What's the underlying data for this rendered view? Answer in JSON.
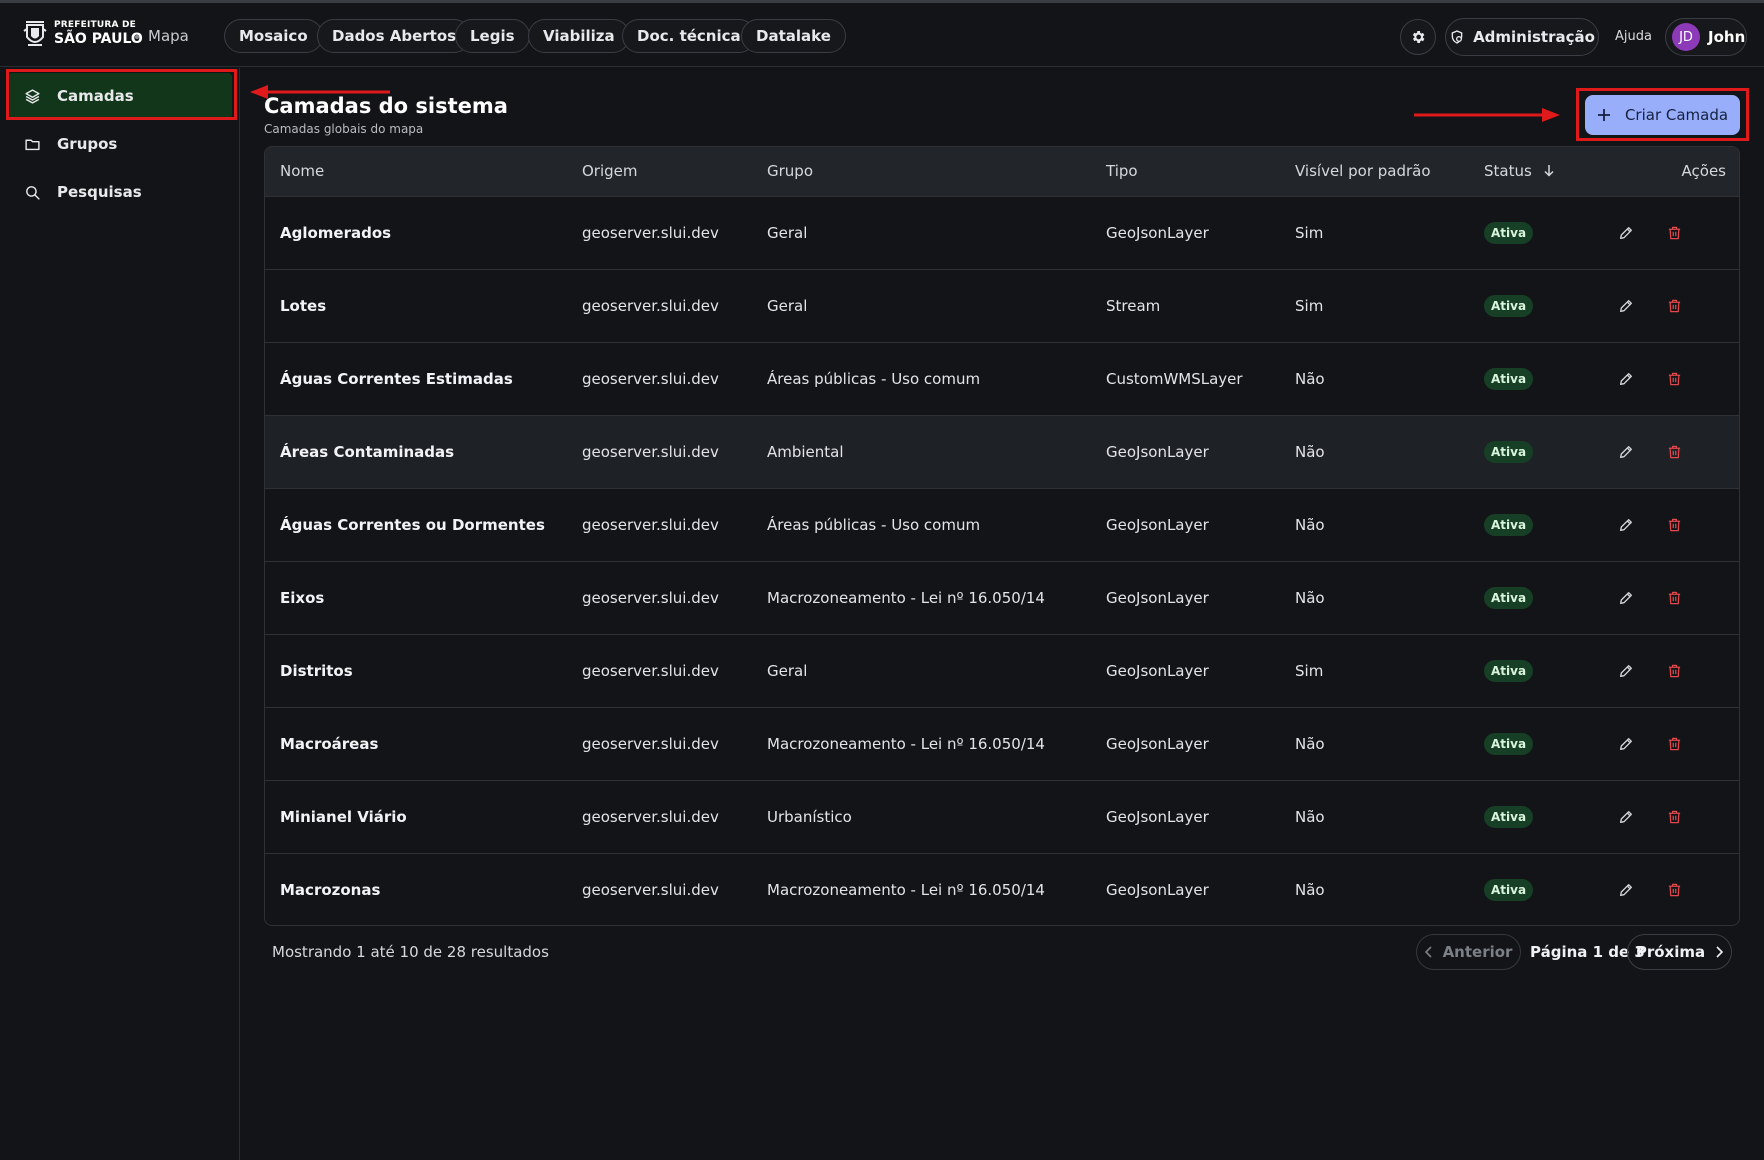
{
  "header": {
    "logo_top": "PREFEITURA DE",
    "logo_main": "SÃO PAULO",
    "app_name": "Mapa",
    "nav": [
      "Mosaico",
      "Dados Abertos",
      "Legis",
      "Viabiliza",
      "Doc. técnica",
      "Datalake"
    ],
    "admin_label": "Administração",
    "help_label": "Ajuda",
    "user_initials": "JD",
    "user_name": "John"
  },
  "sidebar": {
    "items": [
      {
        "label": "Camadas",
        "icon": "layers-icon",
        "active": true
      },
      {
        "label": "Grupos",
        "icon": "folder-icon",
        "active": false
      },
      {
        "label": "Pesquisas",
        "icon": "search-icon",
        "active": false
      }
    ]
  },
  "main": {
    "title": "Camadas do sistema",
    "subtitle": "Camadas globais do mapa",
    "create_label": "Criar Camada",
    "columns": [
      "Nome",
      "Origem",
      "Grupo",
      "Tipo",
      "Visível por padrão",
      "Status",
      "Ações"
    ],
    "rows": [
      {
        "nome": "Aglomerados",
        "origem": "geoserver.slui.dev",
        "grupo": "Geral",
        "tipo": "GeoJsonLayer",
        "visivel": "Sim",
        "status": "Ativa"
      },
      {
        "nome": "Lotes",
        "origem": "geoserver.slui.dev",
        "grupo": "Geral",
        "tipo": "Stream",
        "visivel": "Sim",
        "status": "Ativa"
      },
      {
        "nome": "Águas Correntes Estimadas",
        "origem": "geoserver.slui.dev",
        "grupo": "Áreas públicas - Uso comum",
        "tipo": "CustomWMSLayer",
        "visivel": "Não",
        "status": "Ativa"
      },
      {
        "nome": "Áreas Contaminadas",
        "origem": "geoserver.slui.dev",
        "grupo": "Ambiental",
        "tipo": "GeoJsonLayer",
        "visivel": "Não",
        "status": "Ativa"
      },
      {
        "nome": "Águas Correntes ou Dormentes",
        "origem": "geoserver.slui.dev",
        "grupo": "Áreas públicas - Uso comum",
        "tipo": "GeoJsonLayer",
        "visivel": "Não",
        "status": "Ativa"
      },
      {
        "nome": "Eixos",
        "origem": "geoserver.slui.dev",
        "grupo": "Macrozoneamento - Lei nº 16.050/14",
        "tipo": "GeoJsonLayer",
        "visivel": "Não",
        "status": "Ativa"
      },
      {
        "nome": "Distritos",
        "origem": "geoserver.slui.dev",
        "grupo": "Geral",
        "tipo": "GeoJsonLayer",
        "visivel": "Sim",
        "status": "Ativa"
      },
      {
        "nome": "Macroáreas",
        "origem": "geoserver.slui.dev",
        "grupo": "Macrozoneamento - Lei nº 16.050/14",
        "tipo": "GeoJsonLayer",
        "visivel": "Não",
        "status": "Ativa"
      },
      {
        "nome": "Minianel Viário",
        "origem": "geoserver.slui.dev",
        "grupo": "Urbanístico",
        "tipo": "GeoJsonLayer",
        "visivel": "Não",
        "status": "Ativa"
      },
      {
        "nome": "Macrozonas",
        "origem": "geoserver.slui.dev",
        "grupo": "Macrozoneamento - Lei nº 16.050/14",
        "tipo": "GeoJsonLayer",
        "visivel": "Não",
        "status": "Ativa"
      }
    ],
    "results_text": "Mostrando 1 até 10 de 28 resultados",
    "pagination": {
      "prev": "Anterior",
      "page_info": "Página 1 de 3",
      "next": "Próxima"
    }
  },
  "colors": {
    "background": "#121417",
    "accent_button": "#99aefa",
    "active_sidebar": "#11361a",
    "status_badge": "#173f25",
    "annotation": "#e0191b",
    "avatar": "#8c3ab8"
  }
}
